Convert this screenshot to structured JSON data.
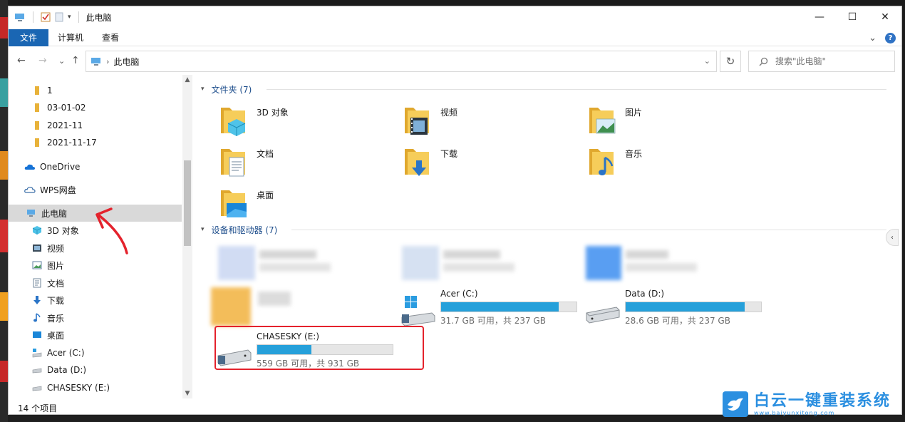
{
  "window": {
    "title": "此电脑",
    "controls": {
      "minimize": "—",
      "maximize": "☐",
      "close": "✕"
    }
  },
  "ribbon": {
    "tabs": [
      {
        "label": "文件"
      },
      {
        "label": "计算机"
      },
      {
        "label": "查看"
      }
    ],
    "expand": "⌄",
    "help": "?"
  },
  "nav": {
    "back": "←",
    "forward": "→",
    "recent": "⌄",
    "up": "↑",
    "breadcrumb": "此电脑",
    "dropdown": "⌄",
    "refresh": "↻",
    "search_placeholder": "搜索\"此电脑\""
  },
  "sidebar": {
    "items": [
      {
        "label": "1",
        "icon": "folder-icon"
      },
      {
        "label": "03-01-02",
        "icon": "folder-icon"
      },
      {
        "label": "2021-11",
        "icon": "folder-icon"
      },
      {
        "label": "2021-11-17",
        "icon": "folder-icon"
      },
      {
        "label": "OneDrive",
        "icon": "onedrive-cloud-icon"
      },
      {
        "label": "WPS网盘",
        "icon": "wps-cloud-icon"
      },
      {
        "label": "此电脑",
        "icon": "this-pc-icon",
        "selected": true
      },
      {
        "label": "3D 对象",
        "icon": "3d-objects-icon"
      },
      {
        "label": "视频",
        "icon": "video-icon"
      },
      {
        "label": "图片",
        "icon": "pictures-icon"
      },
      {
        "label": "文档",
        "icon": "documents-icon"
      },
      {
        "label": "下载",
        "icon": "download-icon"
      },
      {
        "label": "音乐",
        "icon": "music-icon"
      },
      {
        "label": "桌面",
        "icon": "desktop-icon"
      },
      {
        "label": "Acer (C:)",
        "icon": "system-drive-icon"
      },
      {
        "label": "Data (D:)",
        "icon": "drive-icon"
      },
      {
        "label": "CHASESKY (E:)",
        "icon": "drive-icon"
      }
    ]
  },
  "status": {
    "item_count": "14 个项目"
  },
  "content": {
    "folders_header": "文件夹 (7)",
    "folders": [
      {
        "label": "3D 对象",
        "icon": "3d-objects-folder-icon"
      },
      {
        "label": "视频",
        "icon": "video-folder-icon"
      },
      {
        "label": "图片",
        "icon": "pictures-folder-icon"
      },
      {
        "label": "文档",
        "icon": "documents-folder-icon"
      },
      {
        "label": "下载",
        "icon": "download-folder-icon"
      },
      {
        "label": "音乐",
        "icon": "music-folder-icon"
      },
      {
        "label": "桌面",
        "icon": "desktop-folder-icon"
      }
    ],
    "drives_header": "设备和驱动器 (7)",
    "drives": [
      {
        "label": "Acer (C:)",
        "size": "31.7 GB 可用，共 237 GB",
        "used_fraction": 0.866,
        "icon": "windows-system-drive-icon"
      },
      {
        "label": "Data (D:)",
        "size": "28.6 GB 可用，共 237 GB",
        "used_fraction": 0.879,
        "icon": "hard-drive-icon"
      },
      {
        "label": "CHASESKY (E:)",
        "size": "559 GB 可用，共 931 GB",
        "used_fraction": 0.4,
        "icon": "external-drive-icon"
      }
    ]
  },
  "watermark": {
    "title": "白云一键重装系统",
    "url": "www.baiyunxitong.com"
  },
  "colors": {
    "accent": "#1a66b3",
    "bar_fill": "#26a0da",
    "highlight": "#e4222c",
    "group_header": "#1e4e8c"
  }
}
